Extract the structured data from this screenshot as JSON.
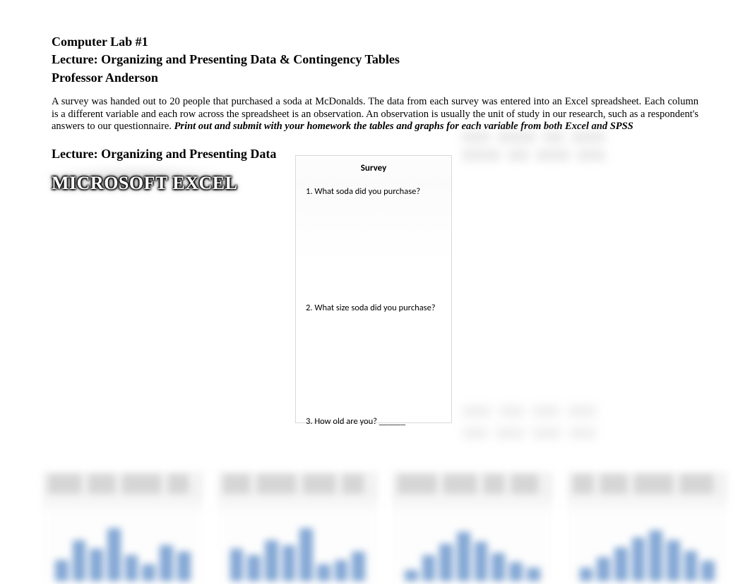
{
  "header": {
    "line1": "Computer Lab #1",
    "line2": "Lecture: Organizing and Presenting Data & Contingency Tables",
    "line3": "Professor Anderson"
  },
  "intro": {
    "text": "A survey was handed out to 20 people that purchased a soda at McDonalds. The data from each survey was entered into an Excel spreadsheet.  Each column is a different variable and each row across the spreadsheet is an observation. An observation is usually the unit of study in our research, such as a respondent's answers to our questionnaire.  ",
    "emphasis": "Print out and submit with your homework the tables and graphs for each variable from both Excel and SPSS"
  },
  "subheading": "Lecture: Organizing and Presenting Data",
  "excel_label": "MICROSOFT EXCEL",
  "survey": {
    "title": "Survey",
    "q1": "1. What soda did you purchase?",
    "q2": "2. What size soda did you purchase?",
    "q3": "3. How old are you? ______"
  }
}
